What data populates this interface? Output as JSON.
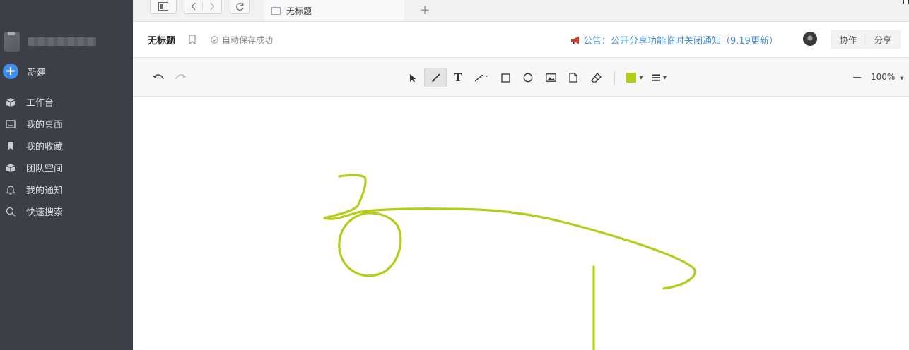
{
  "sidebar": {
    "new_label": "新建",
    "items": [
      {
        "label": "工作台",
        "icon": "box-icon"
      },
      {
        "label": "我的桌面",
        "icon": "desktop-icon"
      },
      {
        "label": "我的收藏",
        "icon": "bookmark-icon"
      },
      {
        "label": "团队空间",
        "icon": "cube-icon"
      },
      {
        "label": "我的通知",
        "icon": "bell-icon"
      },
      {
        "label": "快速搜索",
        "icon": "search-icon"
      }
    ]
  },
  "browser": {
    "tab_title": "无标题"
  },
  "document": {
    "title": "无标题",
    "save_status": "自动保存成功",
    "notice": "公告：公开分享功能临时关闭通知（9.19更新）",
    "collaborate_label": "协作",
    "share_label": "分享"
  },
  "toolbar": {
    "zoom": "100%",
    "active_tool": "pen",
    "stroke_color": "#b5cc18"
  },
  "colors": {
    "sidebar_bg": "#3c3f45",
    "accent": "#3d8ef0",
    "notice_text": "#4a8fd6",
    "ink": "#b5cc18"
  }
}
